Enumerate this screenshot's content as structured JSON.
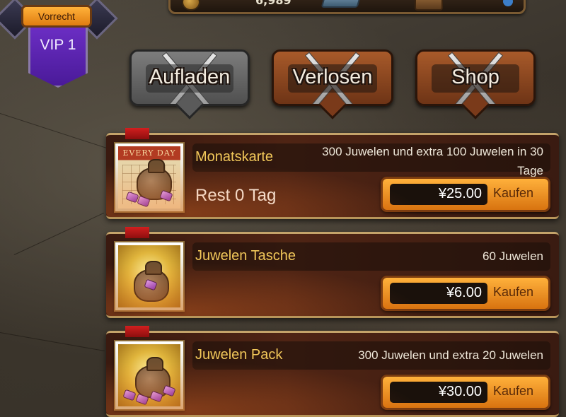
{
  "resources": {
    "coins_value": "6,989"
  },
  "vip": {
    "tag_label": "Vorrecht",
    "level_label": "VIP 1"
  },
  "tabs": [
    {
      "label": "Aufladen",
      "active": true
    },
    {
      "label": "Verlosen",
      "active": false
    },
    {
      "label": "Shop",
      "active": false
    }
  ],
  "items": [
    {
      "title": "Monatskarte",
      "description": "300 Juwelen und extra 100 Juwelen in 30 Tage",
      "rest_label": "Rest 0 Tag",
      "price": "¥25.00",
      "buy_label": "Kaufen",
      "icon": "calendar-bag-icon",
      "icon_caption": "EVERY DAY"
    },
    {
      "title": "Juwelen Tasche",
      "description": "60 Juwelen",
      "price": "¥6.00",
      "buy_label": "Kaufen",
      "icon": "small-gem-bag-icon"
    },
    {
      "title": "Juwelen Pack",
      "description": "300 Juwelen und extra 20 Juwelen",
      "price": "¥30.00",
      "buy_label": "Kaufen",
      "icon": "gem-pack-icon"
    }
  ],
  "colors": {
    "title_gold": "#f2c85a",
    "button_orange": "#ffb13b",
    "vip_purple": "#6d2fc6",
    "active_tab_gray": "#7d7d7d",
    "inactive_tab_copper": "#a85a2a"
  }
}
